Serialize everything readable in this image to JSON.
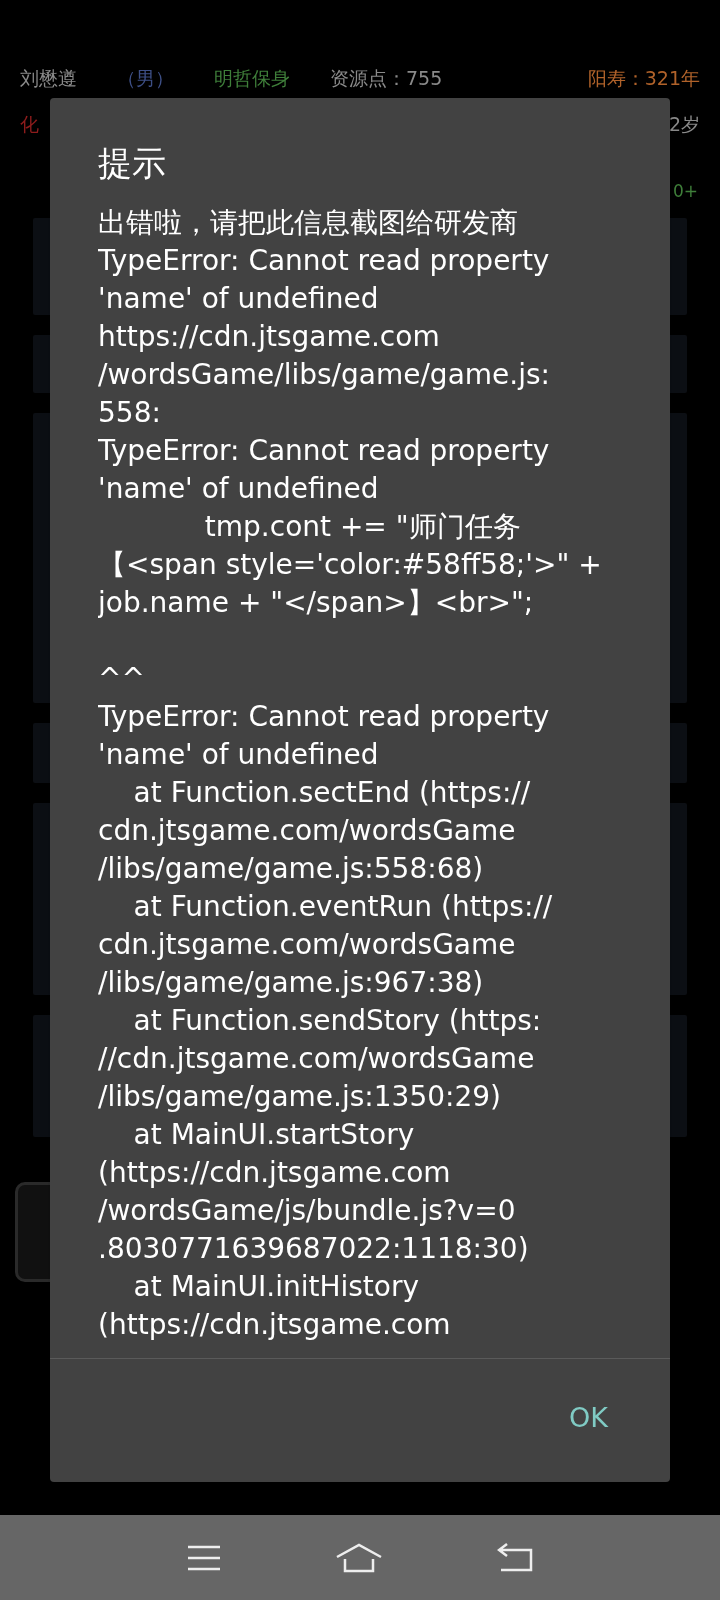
{
  "background": {
    "header": [
      {
        "text": "刘懋遵",
        "color": "#8a8a8a"
      },
      {
        "text": "（男）",
        "color": "#3d4f86"
      },
      {
        "text": "明哲保身",
        "color": "#3f7f3a"
      },
      {
        "text": "资源点：755",
        "color": "#8a8a8a"
      },
      {
        "text": "阳寿：321年",
        "color": "#b0622a"
      }
    ],
    "second_row": [
      {
        "text": "化",
        "color": "#8e1c1c"
      },
      {
        "text": "2岁",
        "color": "#8a8a8a"
      }
    ],
    "fourth_row_end": "0+"
  },
  "dialog": {
    "title": "提示",
    "message_lines": [
      {
        "kind": "text",
        "text": "出错啦，请把此信息截图给研发商"
      },
      {
        "kind": "text",
        "text": "TypeError: Cannot read property"
      },
      {
        "kind": "text",
        "text": "'name' of undefined"
      },
      {
        "kind": "text",
        "text": "https://cdn.jtsgame.com"
      },
      {
        "kind": "text",
        "text": "/wordsGame/libs/game/game.js:"
      },
      {
        "kind": "text",
        "text": "558:"
      },
      {
        "kind": "text",
        "text": "TypeError: Cannot read property"
      },
      {
        "kind": "text",
        "text": "'name' of undefined"
      },
      {
        "kind": "text",
        "text": "            tmp.cont += \"师门任务"
      },
      {
        "kind": "text",
        "text": "【<span style='color:#58ff58;'>\" +"
      },
      {
        "kind": "text",
        "text": "job.name + \"</span>】<br>\";"
      },
      {
        "kind": "blank"
      },
      {
        "kind": "text",
        "text": "^^"
      },
      {
        "kind": "text",
        "text": "TypeError: Cannot read property"
      },
      {
        "kind": "text",
        "text": "'name' of undefined"
      },
      {
        "kind": "text",
        "text": "    at Function.sectEnd (https://"
      },
      {
        "kind": "text",
        "text": "cdn.jtsgame.com/wordsGame"
      },
      {
        "kind": "text",
        "text": "/libs/game/game.js:558:68)"
      },
      {
        "kind": "text",
        "text": "    at Function.eventRun (https://"
      },
      {
        "kind": "text",
        "text": "cdn.jtsgame.com/wordsGame"
      },
      {
        "kind": "text",
        "text": "/libs/game/game.js:967:38)"
      },
      {
        "kind": "text",
        "text": "    at Function.sendStory (https:"
      },
      {
        "kind": "text",
        "text": "//cdn.jtsgame.com/wordsGame"
      },
      {
        "kind": "text",
        "text": "/libs/game/game.js:1350:29)"
      },
      {
        "kind": "text",
        "text": "    at MainUI.startStory"
      },
      {
        "kind": "text",
        "text": "(https://cdn.jtsgame.com"
      },
      {
        "kind": "text",
        "text": "/wordsGame/js/bundle.js?v=0"
      },
      {
        "kind": "text",
        "text": ".8030771639687022:1118:30)"
      },
      {
        "kind": "text",
        "text": "    at MainUI.initHistory"
      },
      {
        "kind": "text",
        "text": "(https://cdn.jtsgame.com"
      }
    ],
    "buttons": [
      "OK"
    ]
  }
}
